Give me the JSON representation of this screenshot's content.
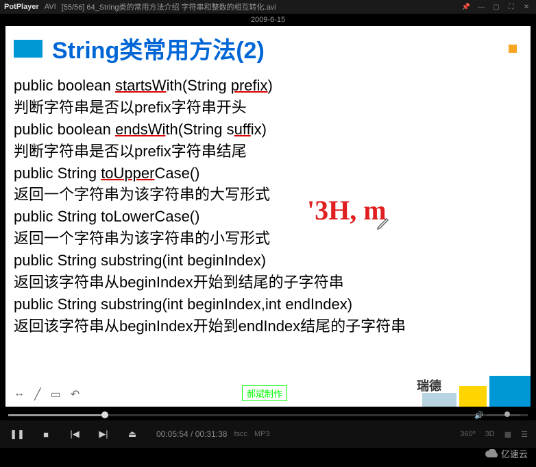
{
  "titlebar": {
    "app": "PotPlayer",
    "format": "AVI",
    "file": "[55/56] 64_String类的常用方法介绍 字符串和整数的相互转化.avi"
  },
  "date": "2009-6-15",
  "slide": {
    "title_en": "String",
    "title_zh": "类常用方法(2)",
    "lines": [
      "public boolean startsWith(String prefix)",
      "判断字符串是否以prefix字符串开头",
      "public boolean endsWith(String suffix)",
      "判断字符串是否以prefix字符串结尾",
      "public String toUpperCase()",
      "返回一个字符串为该字符串的大写形式",
      "public String toLowerCase()",
      "返回一个字符串为该字符串的小写形式",
      "public String substring(int beginIndex)",
      "返回该字符串从beginIndex开始到结尾的子字符串",
      "public String substring(int beginIndex,int endIndex)",
      "返回该字符串从beginIndex开始到endIndex结尾的子字符串"
    ],
    "annotation": "'3H, m",
    "ruide": "瑞德",
    "credit": "郝斌制作"
  },
  "player": {
    "current": "00:05:54",
    "total": "00:31:38",
    "codec1": "tscc",
    "codec2": "MP3",
    "right": [
      "360º",
      "3D"
    ]
  },
  "watermark": "亿速云"
}
